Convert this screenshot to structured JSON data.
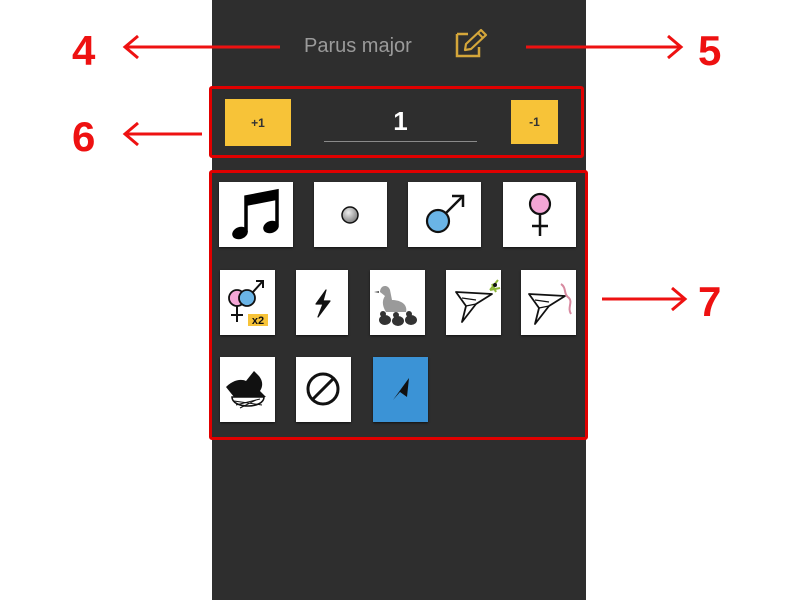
{
  "header": {
    "species_name": "Parus major",
    "edit_icon": "edit-note-icon"
  },
  "counter": {
    "increment_label": "+1",
    "decrement_label": "-1",
    "value": "1"
  },
  "behaviour_icons": [
    {
      "name": "song-icon",
      "selected": false
    },
    {
      "name": "call-dot-icon",
      "selected": false
    },
    {
      "name": "male-icon",
      "selected": false
    },
    {
      "name": "female-icon",
      "selected": false
    },
    {
      "name": "pair-x2-icon",
      "badge": "x2",
      "selected": false
    },
    {
      "name": "alarm-lightning-icon",
      "selected": false
    },
    {
      "name": "family-with-young-icon",
      "selected": false
    },
    {
      "name": "carrying-food-icon",
      "selected": false
    },
    {
      "name": "carrying-nest-material-icon",
      "selected": false
    },
    {
      "name": "nest-icon",
      "selected": false
    },
    {
      "name": "no-observation-icon",
      "selected": false
    },
    {
      "name": "direction-arrow-icon",
      "selected": true
    }
  ],
  "annotations": {
    "callout_4": "4",
    "callout_5": "5",
    "callout_6": "6",
    "callout_7": "7"
  },
  "colors": {
    "panel_background": "#2e2e2e",
    "counter_button": "#f7c338",
    "highlight_frame": "#e00000",
    "selected_tile": "#3b93d6",
    "male_symbol": "#6ab4e6",
    "female_symbol": "#f4a6d6",
    "edit_icon": "#d4a63a"
  }
}
